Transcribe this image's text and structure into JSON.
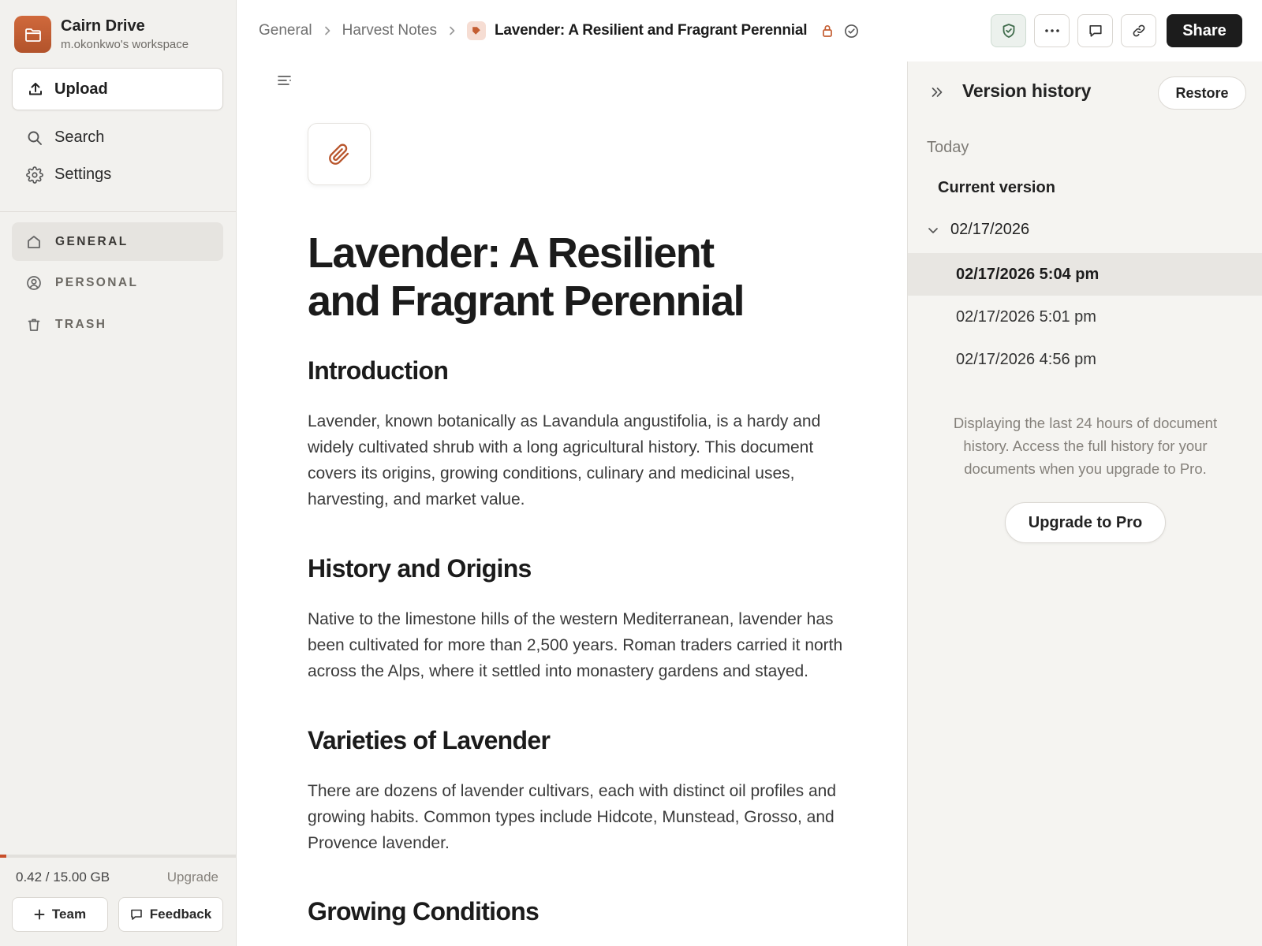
{
  "workspace": {
    "name": "Cairn Drive",
    "subtitle": "m.okonkwo's workspace",
    "logo_icon": "folder-icon",
    "brand_color": "#c45d31"
  },
  "sidebar": {
    "upload_label": "Upload",
    "nav": [
      {
        "label": "Search",
        "icon": "search-icon"
      },
      {
        "label": "Settings",
        "icon": "gear-icon"
      }
    ],
    "folders": [
      {
        "label": "GENERAL",
        "icon": "home-icon",
        "active": true
      },
      {
        "label": "PERSONAL",
        "icon": "user-circle-icon",
        "active": false
      },
      {
        "label": "TRASH",
        "icon": "trash-icon",
        "active": false
      }
    ],
    "storage": {
      "text": "0.42 / 15.00 GB",
      "used_fraction": 0.028,
      "upgrade_label": "Upgrade"
    },
    "team_label": "Team",
    "feedback_label": "Feedback"
  },
  "topbar": {
    "breadcrumbs": [
      "General",
      "Harvest Notes"
    ],
    "current": "Lavender: A Resilient and Fragrant Perennial",
    "share_label": "Share",
    "icons": [
      "lock-icon",
      "check-circle-icon",
      "shield-check-icon",
      "more-icon",
      "comment-icon",
      "link-icon"
    ]
  },
  "document": {
    "icon": "paperclip-icon",
    "title": "Lavender: A Resilient and Fragrant Perennial",
    "sections": [
      {
        "heading": "Introduction",
        "body": "Lavender, known botanically as Lavandula angustifolia, is a hardy and widely cultivated shrub with a long agricultural history. This document covers its origins, growing conditions, culinary and medicinal uses, harvesting, and market value."
      },
      {
        "heading": "History and Origins",
        "body": "Native to the limestone hills of the western Mediterranean, lavender has been cultivated for more than 2,500 years. Roman traders carried it north across the Alps, where it settled into monastery gardens and stayed."
      },
      {
        "heading": "Varieties of Lavender",
        "body": "There are dozens of lavender cultivars, each with distinct oil profiles and growing habits. Common types include Hidcote, Munstead, Grosso, and Provence lavender."
      },
      {
        "heading": "Growing Conditions",
        "body": ""
      }
    ]
  },
  "version_history": {
    "title": "Version history",
    "restore_label": "Restore",
    "group_label": "Today",
    "current_label": "Current version",
    "date_group": "02/17/2026",
    "versions": [
      {
        "label": "02/17/2026 5:04 pm",
        "active": true
      },
      {
        "label": "02/17/2026 5:01 pm",
        "active": false
      },
      {
        "label": "02/17/2026 4:56 pm",
        "active": false
      }
    ],
    "note": "Displaying the last 24 hours of document history. Access the full history for your documents when you upgrade to Pro.",
    "upgrade_label": "Upgrade to Pro"
  }
}
